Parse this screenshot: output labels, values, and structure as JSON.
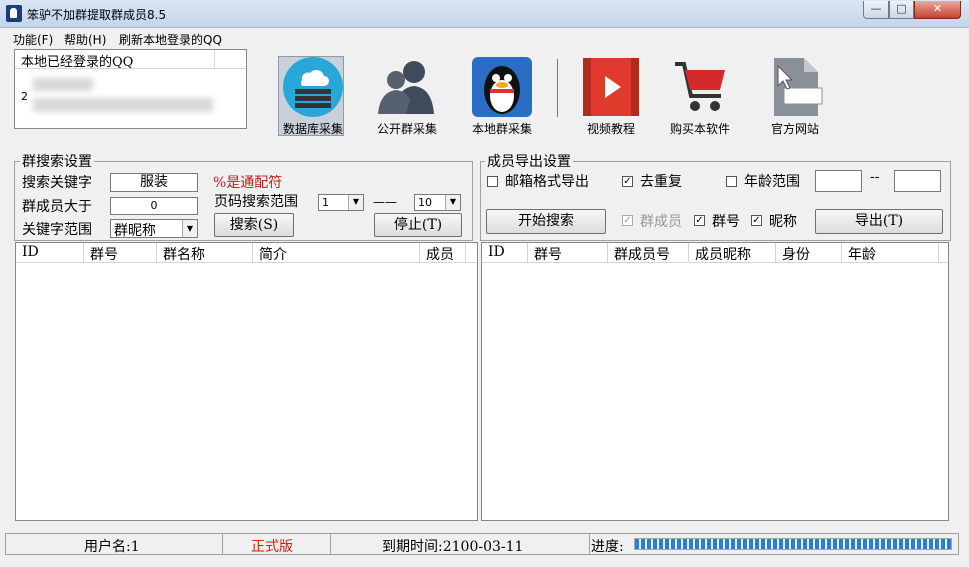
{
  "window": {
    "title": "笨驴不加群提取群成员8.5",
    "min": "—",
    "max": "□",
    "close": "✕"
  },
  "menu": [
    "功能(F)",
    "帮助(H)",
    "刷新本地登录的QQ"
  ],
  "qq_panel": {
    "header": "本地已经登录的QQ",
    "visible_char": "2"
  },
  "toolbar": [
    {
      "label": "数据库采集",
      "icon": "database-cloud-icon"
    },
    {
      "label": "公开群采集",
      "icon": "people-icon"
    },
    {
      "label": "本地群采集",
      "icon": "qq-penguin-icon"
    },
    {
      "label": "视频教程",
      "icon": "video-play-icon"
    },
    {
      "label": "购买本软件",
      "icon": "shopping-cart-icon"
    },
    {
      "label": "官方网站",
      "icon": "url-file-icon"
    }
  ],
  "group_search": {
    "title": "群搜索设置",
    "keyword_label": "搜索关键字",
    "keyword_value": "服装",
    "wildcard_note": "%是通配符",
    "members_label": "群成员大于",
    "members_value": "0",
    "page_range_label": "页码搜索范围",
    "page_from": "1",
    "page_dash": "——",
    "page_to": "10",
    "scope_label": "关键字范围",
    "scope_value": "群昵称",
    "search_button": "搜索(S)",
    "stop_button": "停止(T)"
  },
  "group_export": {
    "title": "成员导出设置",
    "email_format": "邮箱格式导出",
    "dedupe": "去重复",
    "age_range": "年龄范围",
    "age_dash": "--",
    "age_from": "",
    "age_to": "",
    "start_button": "开始搜索",
    "chk_members": "群成员",
    "chk_group_no": "群号",
    "chk_nickname": "昵称",
    "export_button": "导出(T)"
  },
  "checks": {
    "email_format": false,
    "dedupe": true,
    "age_range": false,
    "members": true,
    "group_no": true,
    "nickname": true
  },
  "left_list": {
    "columns": [
      "ID",
      "群号",
      "群名称",
      "简介",
      "成员"
    ]
  },
  "right_list": {
    "columns": [
      "ID",
      "群号",
      "群成员号",
      "成员昵称",
      "身份",
      "年龄"
    ]
  },
  "status": {
    "username": "用户名:1",
    "edition": "正式版",
    "expiry": "到期时间:2100-03-11",
    "progress_label": "进度:",
    "progress": 1.0
  },
  "colors": {
    "edition": "#d81e06",
    "wildcard_note": "#c0201a",
    "progress": "#2a7fd4"
  }
}
